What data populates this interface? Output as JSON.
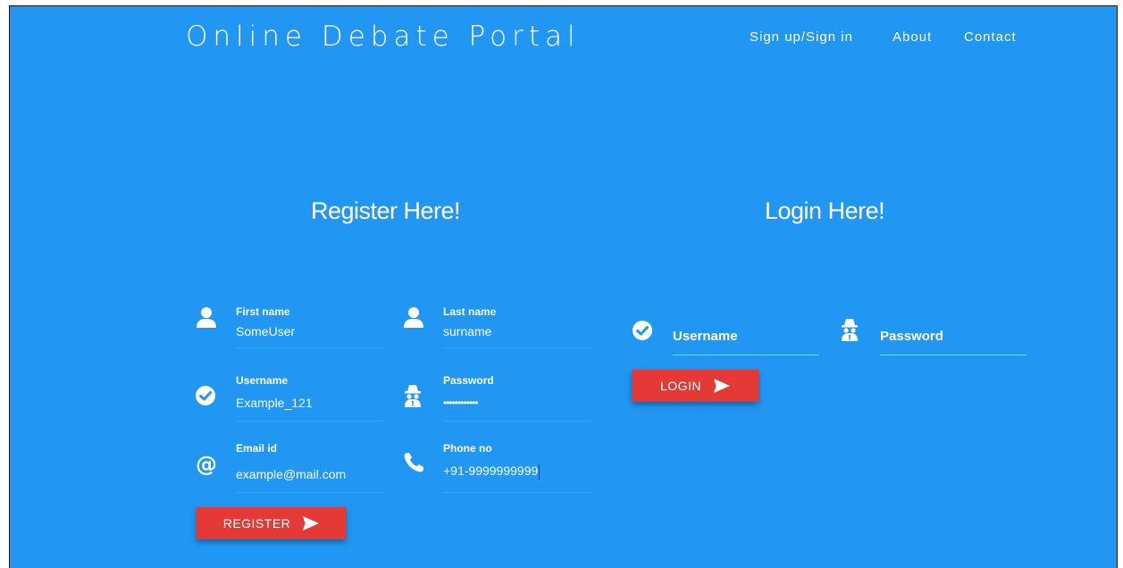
{
  "header": {
    "brand": "Online Debate Portal",
    "nav": [
      "Sign up/Sign in",
      "About",
      "Contact"
    ]
  },
  "register": {
    "title": "Register Here!",
    "first_name": {
      "label": "First name",
      "value": "SomeUser"
    },
    "last_name": {
      "label": "Last name",
      "value": "surname"
    },
    "username": {
      "label": "Username",
      "value": "Example_121"
    },
    "password": {
      "label": "Password",
      "value": "••••••••••••"
    },
    "email": {
      "label": "Email id",
      "value": "example@mail.com"
    },
    "phone": {
      "label": "Phone no",
      "value": "+91-9999999999"
    },
    "button": "REGISTER"
  },
  "login": {
    "title": "Login Here!",
    "username_placeholder": "Username",
    "password_placeholder": "Password",
    "button": "LOGIN"
  },
  "colors": {
    "background": "#2196f3",
    "button": "#e53935",
    "active_underline": "#3fbf6b"
  }
}
